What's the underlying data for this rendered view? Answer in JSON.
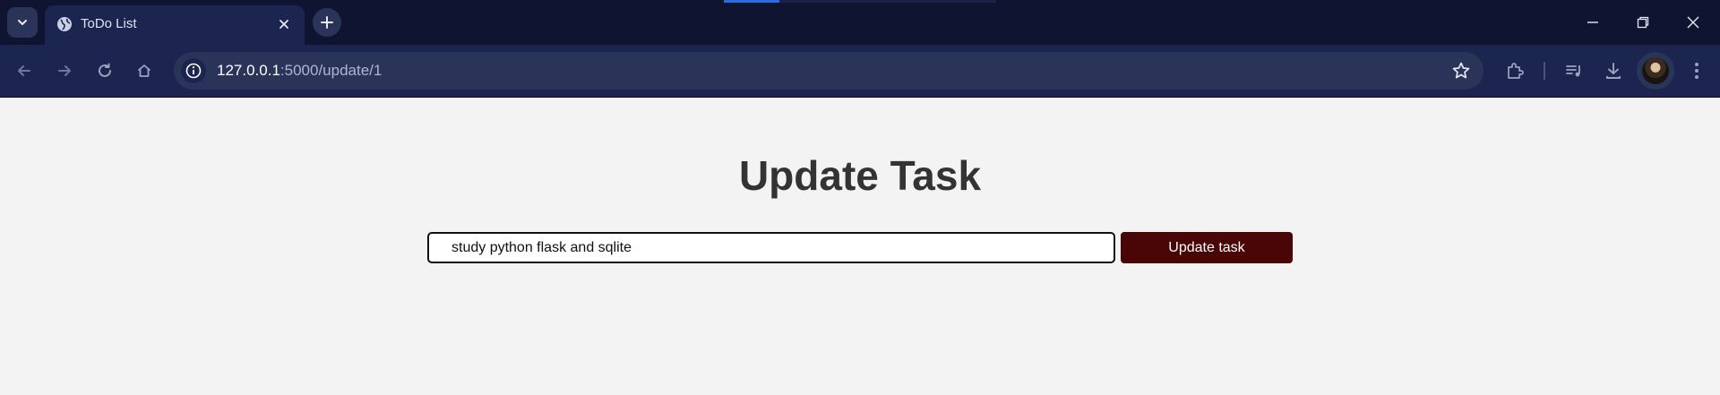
{
  "browser": {
    "tab": {
      "title": "ToDo List"
    },
    "address_bar": {
      "url_host": "127.0.0.1",
      "url_path": ":5000/update/1"
    },
    "colors": {
      "chrome_bg": "#0f1430",
      "toolbar_bg": "#1b2550",
      "accent": "#2d6be0"
    },
    "icons": {
      "tab_search": "chevron-down-icon",
      "favicon": "globe-icon",
      "tab_close": "close-icon",
      "new_tab": "plus-icon",
      "back": "arrow-left-icon",
      "forward": "arrow-right-icon",
      "reload": "reload-icon",
      "home": "home-icon",
      "site_info": "info-icon",
      "bookmark": "star-icon",
      "extensions": "puzzle-icon",
      "media": "media-control-icon",
      "downloads": "download-icon",
      "menu": "kebab-menu-icon",
      "minimize": "minimize-icon",
      "restore": "restore-icon",
      "close_window": "close-window-icon"
    }
  },
  "page": {
    "heading": "Update Task",
    "input": {
      "value": "study python flask and sqlite"
    },
    "button": {
      "label": "Update task"
    },
    "colors": {
      "button_bg": "#4a0606",
      "heading": "#333333",
      "background": "#f3f3f3"
    }
  }
}
